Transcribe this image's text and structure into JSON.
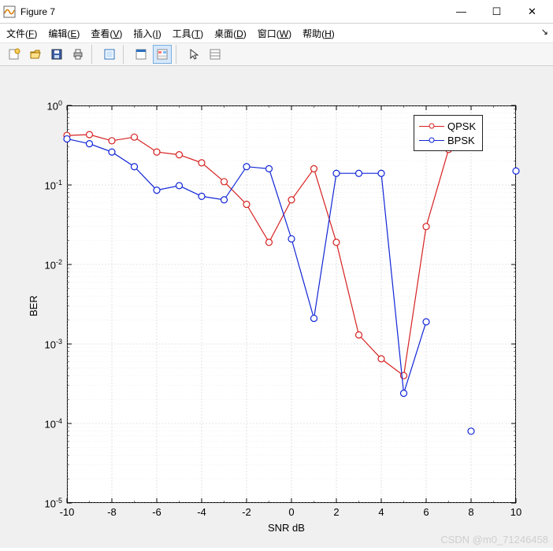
{
  "window": {
    "title": "Figure 7",
    "buttons": {
      "min": "—",
      "max": "☐",
      "close": "✕"
    }
  },
  "menu": {
    "file": "文件(F)",
    "edit": "编辑(E)",
    "view": "查看(V)",
    "insert": "插入(I)",
    "tools": "工具(T)",
    "desktop": "桌面(D)",
    "window": "窗口(W)",
    "help": "帮助(H)"
  },
  "toolbar_names": [
    "new-figure",
    "open",
    "save",
    "print",
    "|",
    "dataexplorer",
    "|",
    "linkplot",
    "colorbar",
    "|",
    "pointer",
    "inspector"
  ],
  "legend": {
    "series1": "QPSK",
    "series2": "BPSK"
  },
  "axes": {
    "xlabel": "SNR  dB",
    "ylabel": "BER",
    "xticks": [
      "-10",
      "-8",
      "-6",
      "-4",
      "-2",
      "0",
      "2",
      "4",
      "6",
      "8",
      "10"
    ],
    "yticks_exp": [
      0,
      -1,
      -2,
      -3,
      -4,
      -5
    ]
  },
  "watermark": "CSDN @m0_71246458",
  "chart_data": {
    "type": "line",
    "xlabel": "SNR  dB",
    "ylabel": "BER",
    "yscale": "log",
    "x": [
      -10,
      -9,
      -8,
      -7,
      -6,
      -5,
      -4,
      -3,
      -2,
      -1,
      0,
      1,
      2,
      3,
      4,
      5,
      6,
      7,
      8,
      9,
      10
    ],
    "xlim": [
      -10,
      10
    ],
    "ylim": [
      1e-05,
      1
    ],
    "series": [
      {
        "name": "QPSK",
        "color": "#d62020",
        "values": [
          0.42,
          0.43,
          0.36,
          0.4,
          0.26,
          0.24,
          0.19,
          0.11,
          0.057,
          0.019,
          0.065,
          0.16,
          0.019,
          0.0013,
          0.00065,
          0.0004,
          0.03,
          0.28,
          null,
          null,
          null
        ]
      },
      {
        "name": "BPSK",
        "color": "#1025d6",
        "values": [
          0.38,
          0.33,
          0.26,
          0.17,
          0.086,
          0.098,
          0.072,
          0.065,
          0.17,
          0.16,
          0.021,
          0.0021,
          0.14,
          0.14,
          0.14,
          0.00024,
          0.0019,
          null,
          8e-05,
          null,
          0.15
        ]
      }
    ]
  }
}
